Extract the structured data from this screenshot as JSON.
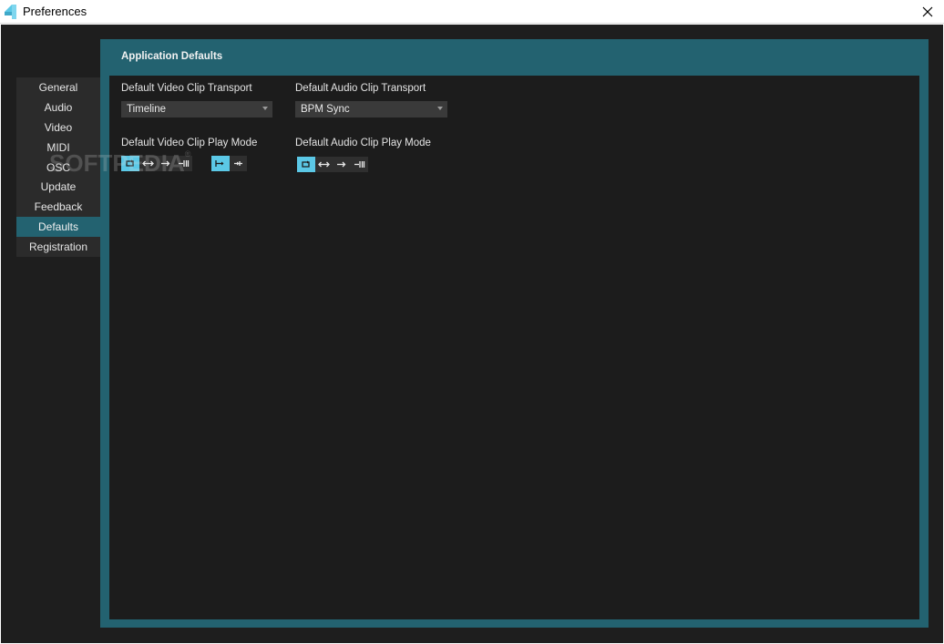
{
  "window": {
    "title": "Preferences"
  },
  "sidebar": {
    "items": [
      {
        "label": "General"
      },
      {
        "label": "Audio"
      },
      {
        "label": "Video"
      },
      {
        "label": "MIDI"
      },
      {
        "label": "OSC"
      },
      {
        "label": "Update"
      },
      {
        "label": "Feedback"
      },
      {
        "label": "Defaults"
      },
      {
        "label": "Registration"
      }
    ],
    "active": "Defaults"
  },
  "panel": {
    "title": "Application Defaults",
    "video_transport": {
      "label": "Default Video Clip Transport",
      "value": "Timeline"
    },
    "audio_transport": {
      "label": "Default Audio Clip Transport",
      "value": "BPM Sync"
    },
    "video_play_mode": {
      "label": "Default Video Clip Play Mode",
      "buttons": [
        "loop-icon",
        "bounce-icon",
        "play-once-icon",
        "play-once-hold-icon"
      ],
      "selected": "loop-icon",
      "direction_buttons": [
        "forward-icon",
        "backward-icon"
      ],
      "direction_selected": "forward-icon"
    },
    "audio_play_mode": {
      "label": "Default Audio Clip Play Mode",
      "buttons": [
        "loop-icon",
        "bounce-icon",
        "play-once-icon",
        "play-once-hold-icon"
      ],
      "selected": "loop-icon"
    }
  },
  "watermark": {
    "text": "SOFTPEDIA",
    "mark": "®"
  },
  "colors": {
    "background": "#1e1e1e",
    "panel": "#236270",
    "accent": "#5bc8e6",
    "sidebar": "#2b2b2b"
  }
}
